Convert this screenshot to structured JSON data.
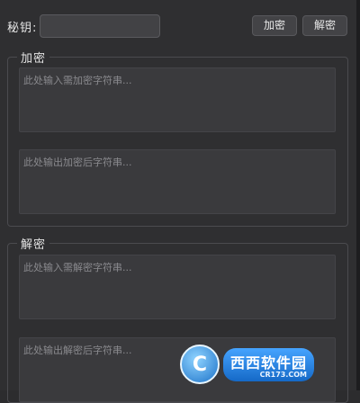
{
  "key": {
    "label": "秘钥:",
    "value": ""
  },
  "toolbar": {
    "encrypt_label": "加密",
    "decrypt_label": "解密"
  },
  "encrypt_group": {
    "title": "加密",
    "input_placeholder": "此处输入需加密字符串...",
    "output_placeholder": "此处输出加密后字符串..."
  },
  "decrypt_group": {
    "title": "解密",
    "input_placeholder": "此处输入需解密字符串...",
    "output_placeholder": "此处输出解密后字符串..."
  },
  "watermark": {
    "glyph": "C",
    "brand": "西西软件园",
    "site": "CR173.COM"
  }
}
